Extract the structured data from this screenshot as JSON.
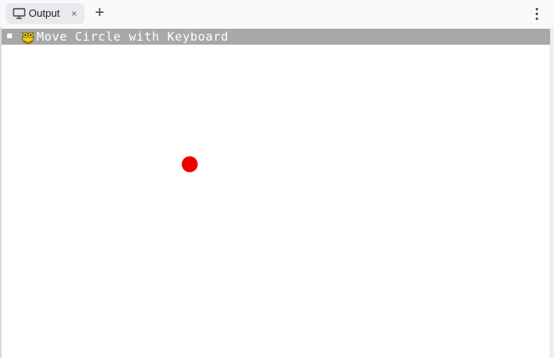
{
  "tab": {
    "label": "Output",
    "icon": "monitor-icon",
    "close_glyph": "×"
  },
  "toolbar": {
    "new_tab_glyph": "+",
    "more_icon": "more-vert-icon"
  },
  "game_window": {
    "title": "Move Circle with Keyboard",
    "logo_icon": "pygame-snake-icon",
    "titlebar_color": "#a8a8a8",
    "background_color": "#ffffff"
  },
  "game": {
    "circle_color": "#ee0000",
    "circle_shape": "circle"
  }
}
